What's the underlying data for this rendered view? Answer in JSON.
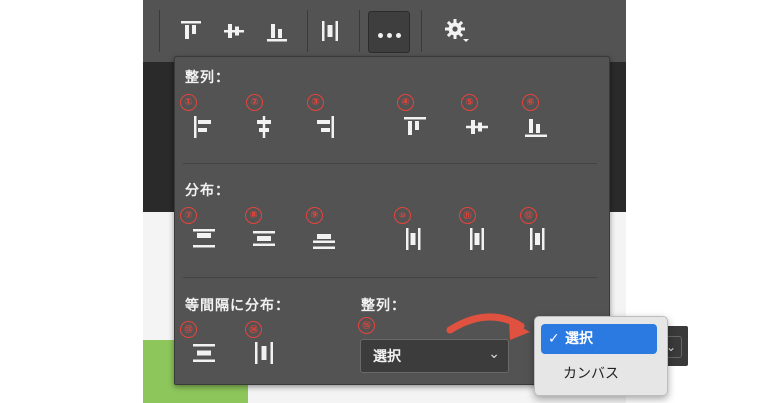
{
  "toolbar": {
    "buttons": [
      {
        "name": "align-top-edges-icon"
      },
      {
        "name": "align-vertical-centers-icon"
      },
      {
        "name": "align-bottom-edges-icon"
      },
      {
        "name": "distribute-horizontal-space-icon"
      },
      {
        "name": "more-options-icon"
      },
      {
        "name": "gear-icon"
      }
    ]
  },
  "panel": {
    "align_title": "整列：",
    "distribute_title": "分布：",
    "space_title": "等間隔に分布：",
    "align_to_title": "整列：",
    "markers": [
      "①",
      "②",
      "③",
      "④",
      "⑤",
      "⑥",
      "⑦",
      "⑧",
      "⑨",
      "⑩",
      "⑪",
      "⑫",
      "⑬",
      "⑭",
      "⑮"
    ],
    "align_to_select": {
      "value": "選択"
    }
  },
  "dropdown": {
    "options": [
      {
        "label": "選択",
        "selected": true
      },
      {
        "label": "カンバス",
        "selected": false
      }
    ]
  },
  "colors": {
    "panel_bg": "#535353",
    "marker_red": "#e8433b",
    "select_highlight": "#2a7ae2"
  }
}
